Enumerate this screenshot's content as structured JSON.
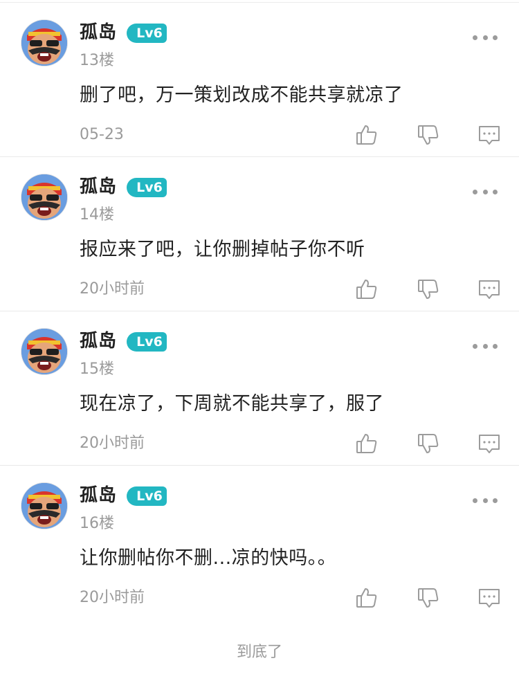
{
  "comments": [
    {
      "user": "孤岛",
      "level": "Lv6",
      "floor": "13楼",
      "text": "删了吧，万一策划改成不能共享就凉了",
      "time": "05-23"
    },
    {
      "user": "孤岛",
      "level": "Lv6",
      "floor": "14楼",
      "text": "报应来了吧，让你删掉帖子你不听",
      "time": "20小时前"
    },
    {
      "user": "孤岛",
      "level": "Lv6",
      "floor": "15楼",
      "text": "现在凉了，下周就不能共享了，服了",
      "time": "20小时前"
    },
    {
      "user": "孤岛",
      "level": "Lv6",
      "floor": "16楼",
      "text": "让你删帖你不删...凉的快吗。。",
      "time": "20小时前"
    }
  ],
  "footer_text": "到底了",
  "colors": {
    "level_badge": "#22b7c2",
    "muted_text": "#9a9a9a",
    "icon": "#9b9b9b"
  }
}
